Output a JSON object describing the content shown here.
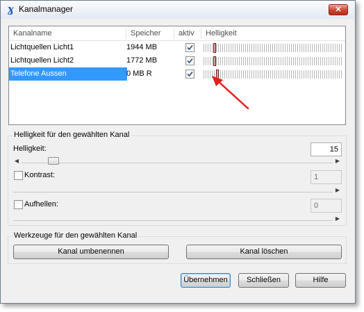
{
  "window": {
    "title": "Kanalmanager",
    "icon": "app-logo-icon",
    "close_label": "✕"
  },
  "listview": {
    "columns": [
      "Kanalname",
      "Speicher",
      "aktiv",
      "Helligkeit"
    ],
    "rows": [
      {
        "name": "Lichtquellen Licht1",
        "speicher": "1944 MB",
        "aktiv": true,
        "helligkeit_level": 0.05,
        "selected": false
      },
      {
        "name": "Lichtquellen Licht2",
        "speicher": "1772 MB",
        "aktiv": true,
        "helligkeit_level": 0.05,
        "selected": false
      },
      {
        "name": "Telefone Aussen",
        "speicher": "0 MB R",
        "aktiv": true,
        "helligkeit_level": 0.07,
        "selected": true
      }
    ]
  },
  "annotation": {
    "arrow_color": "#e0211b"
  },
  "channel_group": {
    "title": "Helligkeit für den gewählten Kanal",
    "helligkeit": {
      "label": "Helligkeit:",
      "value": "15"
    },
    "kontrast": {
      "label": "Kontrast:",
      "checked": false,
      "value": "1"
    },
    "aufhellen": {
      "label": "Aufhellen:",
      "checked": false,
      "value": "0"
    }
  },
  "tools_group": {
    "title": "Werkzeuge für den gewählten Kanal",
    "rename_label": "Kanal umbenennen",
    "delete_label": "Kanal löschen"
  },
  "footer": {
    "apply_label": "Übernehmen",
    "close_label": "Schließen",
    "help_label": "Hilfe"
  }
}
